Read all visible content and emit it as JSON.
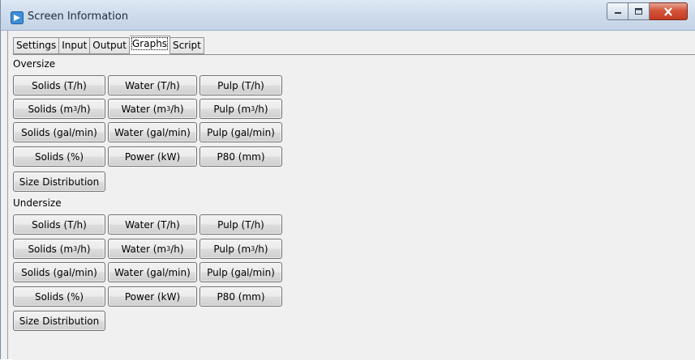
{
  "window": {
    "title": "Screen Information",
    "controls": {
      "minimize": "minimize",
      "maximize": "maximize",
      "close": "close"
    }
  },
  "tabs": [
    {
      "label": "Settings",
      "active": false
    },
    {
      "label": "Input",
      "active": false
    },
    {
      "label": "Output",
      "active": false
    },
    {
      "label": "Graphs",
      "active": true
    },
    {
      "label": "Script",
      "active": false
    }
  ],
  "oversize": {
    "label": "Oversize",
    "row1": {
      "solids": "Solids (T/h)",
      "water": "Water (T/h)",
      "pulp": "Pulp (T/h)"
    },
    "row2": {
      "solids": "Solids (m",
      "water": "Water (m",
      "pulp": "Pulp (m",
      "sup": "3",
      "suffix": "/h)"
    },
    "row3": {
      "solids": "Solids (gal/min)",
      "water": "Water (gal/min)",
      "pulp": "Pulp (gal/min)"
    },
    "row4": {
      "solids": "Solids (%)",
      "power": "Power (kW)",
      "p80": "P80 (mm)"
    },
    "size_distribution": "Size Distribution"
  },
  "undersize": {
    "label": "Undersize",
    "row1": {
      "solids": "Solids (T/h)",
      "water": "Water (T/h)",
      "pulp": "Pulp (T/h)"
    },
    "row2": {
      "solids": "Solids (m",
      "water": "Water (m",
      "pulp": "Pulp (m",
      "sup": "3",
      "suffix": "/h)"
    },
    "row3": {
      "solids": "Solids (gal/min)",
      "water": "Water (gal/min)",
      "pulp": "Pulp (gal/min)"
    },
    "row4": {
      "solids": "Solids (%)",
      "power": "Power (kW)",
      "p80": "P80 (mm)"
    },
    "size_distribution": "Size Distribution"
  },
  "colors": {
    "titlebar": "#cfdcec",
    "window_bg": "#f0f0f0",
    "close_button": "#c23b22"
  }
}
